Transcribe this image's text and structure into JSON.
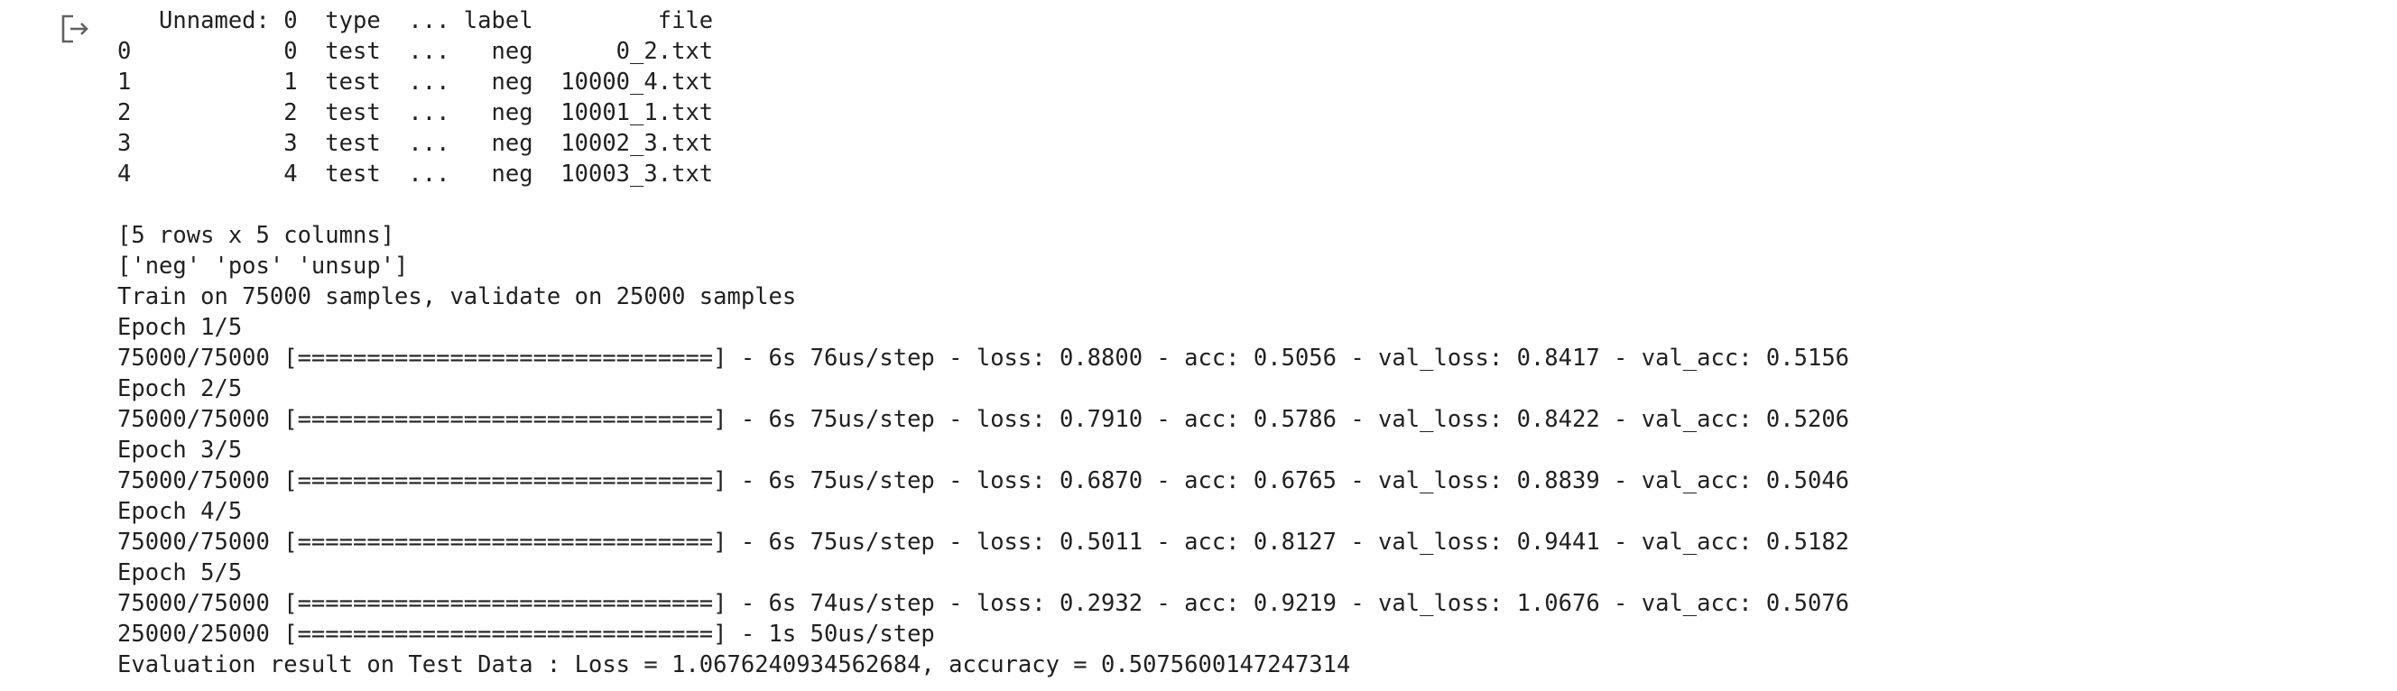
{
  "output": {
    "icon": "output-redirect-icon",
    "lines": [
      "   Unnamed: 0  type  ... label         file",
      "0           0  test  ...   neg      0_2.txt",
      "1           1  test  ...   neg  10000_4.txt",
      "2           2  test  ...   neg  10001_1.txt",
      "3           3  test  ...   neg  10002_3.txt",
      "4           4  test  ...   neg  10003_3.txt",
      "",
      "[5 rows x 5 columns]",
      "['neg' 'pos' 'unsup']",
      "Train on 75000 samples, validate on 25000 samples",
      "Epoch 1/5",
      "75000/75000 [==============================] - 6s 76us/step - loss: 0.8800 - acc: 0.5056 - val_loss: 0.8417 - val_acc: 0.5156",
      "Epoch 2/5",
      "75000/75000 [==============================] - 6s 75us/step - loss: 0.7910 - acc: 0.5786 - val_loss: 0.8422 - val_acc: 0.5206",
      "Epoch 3/5",
      "75000/75000 [==============================] - 6s 75us/step - loss: 0.6870 - acc: 0.6765 - val_loss: 0.8839 - val_acc: 0.5046",
      "Epoch 4/5",
      "75000/75000 [==============================] - 6s 75us/step - loss: 0.5011 - acc: 0.8127 - val_loss: 0.9441 - val_acc: 0.5182",
      "Epoch 5/5",
      "75000/75000 [==============================] - 6s 74us/step - loss: 0.2932 - acc: 0.9219 - val_loss: 1.0676 - val_acc: 0.5076",
      "25000/25000 [==============================] - 1s 50us/step",
      "Evaluation result on Test Data : Loss = 1.0676240934562684, accuracy = 0.5075600147247314"
    ]
  }
}
